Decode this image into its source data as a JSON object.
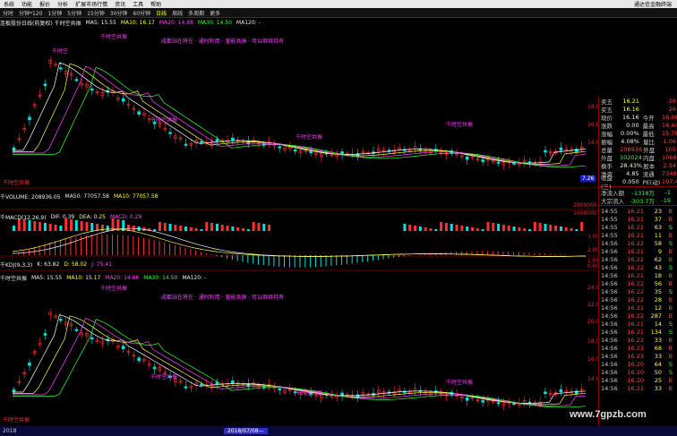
{
  "menubar": {
    "items": [
      "系统",
      "功能",
      "报价",
      "分析",
      "扩展市场行情",
      "资讯",
      "工具",
      "帮助"
    ],
    "title": "通达信金融终端"
  },
  "periods": [
    "分时",
    "分钟*120",
    "1分钟",
    "5分钟",
    "15分钟",
    "30分钟",
    "60分钟",
    "日线",
    "周线",
    "多周期",
    "更多"
  ],
  "active_period": "日线",
  "main_header": {
    "title": "连板股份日线(前复权) 千时空共振",
    "ma5": "MA5: 15.55",
    "ma10": "MA10: 16.17",
    "ma20": "MA20: 14.88",
    "ma30": "MA30: 14.50",
    "ma120": "MA120: -"
  },
  "main_annotation": "成都站在将在 · 通时利用 · 量能共振 · 可以继续持有",
  "signals": {
    "buy_top": "千时空",
    "buy_mid": "千时空共振",
    "sell1": "千时空共振",
    "sell2": "千时空共振",
    "left": "千时空共振"
  },
  "price_axis": [
    "18.00",
    "16.00",
    "14.00"
  ],
  "vol_header": {
    "title": "千VOLUME: 208936.05",
    "ma5": "MA50: 77057.58",
    "ma10": "MA10: 77057.58"
  },
  "vol_axis": [
    "2000000",
    "1000000"
  ],
  "macd_header": {
    "title": "千MACD(12,26,9)",
    "dif": "DIF: 0.39",
    "dea": "DEA: 0.25",
    "macd": "MACD: 0.29"
  },
  "macd_axis": [
    "3.00",
    "2.00",
    "1.00",
    "0.00"
  ],
  "kdj_header": {
    "title": "千KDJ(9,3,3)",
    "k": "K: 63.82",
    "d": "D: 58.02",
    "j": "J: 75.41"
  },
  "main2_header": {
    "title": "千时空共振",
    "ma5": "MA5: 15.55",
    "ma10": "MA10: 15.17",
    "ma20": "MA20: 14.86",
    "ma30": "MA30: 14.50",
    "ma120": "MA120: -"
  },
  "main2_axis": [
    "24.00",
    "22.00",
    "20.00",
    "18.00",
    "16.00",
    "14.00"
  ],
  "quote": {
    "rows": [
      {
        "l": "卖五",
        "v": "16.21",
        "l2": "",
        "v2": "26"
      },
      {
        "l": "买五",
        "v": "16.16",
        "l2": "",
        "v2": "26"
      },
      {
        "l": "现价",
        "v": "16.16",
        "l2": "今开",
        "v2": "16.06"
      },
      {
        "l": "涨跌",
        "v": "0.00",
        "l2": "最高",
        "v2": "16.44"
      },
      {
        "l": "涨幅",
        "v": "0.00%",
        "l2": "最低",
        "v2": "15.78"
      },
      {
        "l": "振幅",
        "v": "4.08%",
        "l2": "量比",
        "v2": "1.06"
      },
      {
        "l": "总量",
        "v": "208936",
        "l2": "外盘",
        "v2": "105"
      },
      {
        "l": "外盘",
        "v": "102024",
        "l2": "内盘",
        "v2": "10691"
      },
      {
        "l": "换手",
        "v": "28.43%",
        "l2": "股本",
        "v2": "2.94"
      },
      {
        "l": "净资",
        "v": "4.85",
        "l2": "流通",
        "v2": "7349"
      },
      {
        "l": "收益(三)",
        "v": "0.050",
        "l2": "PE(动)",
        "v2": "197.4"
      }
    ],
    "flow": [
      {
        "l": "净流入额",
        "v": "-1318万",
        "v2": "-1"
      },
      {
        "l": "大宗流入",
        "v": "-303.7万",
        "v2": "-19"
      }
    ],
    "price_tag": "7.26"
  },
  "ticks": [
    {
      "t": "14:55",
      "p": "16.21",
      "n": "23",
      "d": "B"
    },
    {
      "t": "14:55",
      "p": "16.21",
      "n": "37",
      "d": "B"
    },
    {
      "t": "14:55",
      "p": "16.22",
      "n": "63",
      "d": "S"
    },
    {
      "t": "14:55",
      "p": "16.21",
      "n": "11",
      "d": "B"
    },
    {
      "t": "14:56",
      "p": "16.22",
      "n": "58",
      "d": "S"
    },
    {
      "t": "14:56",
      "p": "16.21",
      "n": "9",
      "d": "B"
    },
    {
      "t": "14:56",
      "p": "16.22",
      "n": "62",
      "d": "B"
    },
    {
      "t": "14:56",
      "p": "16.22",
      "n": "43",
      "d": "S"
    },
    {
      "t": "14:56",
      "p": "16.21",
      "n": "18",
      "d": "B"
    },
    {
      "t": "14:56",
      "p": "16.22",
      "n": "56",
      "d": "B"
    },
    {
      "t": "14:56",
      "p": "16.22",
      "n": "35",
      "d": "S"
    },
    {
      "t": "14:56",
      "p": "16.22",
      "n": "28",
      "d": "B"
    },
    {
      "t": "14:56",
      "p": "16.21",
      "n": "12",
      "d": "B"
    },
    {
      "t": "14:56",
      "p": "16.22",
      "n": "287",
      "d": "B"
    },
    {
      "t": "14:56",
      "p": "16.21",
      "n": "14",
      "d": "S"
    },
    {
      "t": "14:56",
      "p": "16.21",
      "n": "134",
      "d": "S"
    },
    {
      "t": "14:56",
      "p": "16.22",
      "n": "33",
      "d": "B"
    },
    {
      "t": "14:56",
      "p": "16.23",
      "n": "68",
      "d": "B"
    },
    {
      "t": "14:56",
      "p": "16.23",
      "n": "33",
      "d": "B"
    },
    {
      "t": "14:56",
      "p": "16.20",
      "n": "64",
      "d": "S"
    },
    {
      "t": "14:56",
      "p": "16.20",
      "n": "50",
      "d": "S"
    },
    {
      "t": "14:56",
      "p": "16.20",
      "n": "25",
      "d": "B"
    },
    {
      "t": "14:56",
      "p": "16.21",
      "n": "33",
      "d": "B"
    }
  ],
  "bottom": {
    "left": "2018",
    "selected": "2018/07/08—",
    "right": ""
  },
  "watermark": "www.7gpzb.com",
  "colors": {
    "up": "#ff3030",
    "down": "#00e0e0",
    "ma5": "#ffffff",
    "ma10": "#ffff40",
    "ma20": "#ff40ff",
    "ma30": "#33ff33"
  }
}
